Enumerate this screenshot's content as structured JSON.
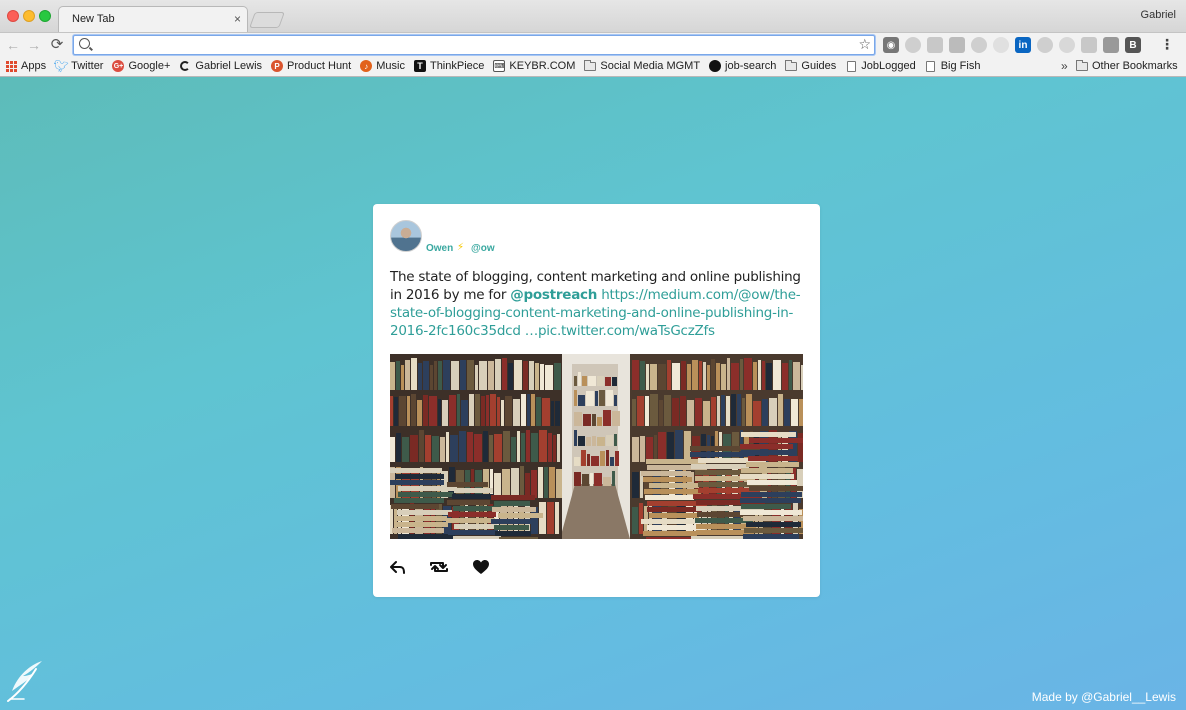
{
  "window": {
    "tab_title": "New Tab",
    "tab_close": "×",
    "profile_name": "Gabriel"
  },
  "toolbar": {
    "address_value": "",
    "address_placeholder": "",
    "extensions": [
      "ghostery-icon",
      "cloud-icon",
      "puzzle-icon",
      "cast-icon",
      "clock-icon",
      "extension-icon",
      "linkedin-icon",
      "settings-icon",
      "gem-icon",
      "window-icon",
      "grid-icon",
      "b-icon"
    ]
  },
  "bookmarks": {
    "items": [
      {
        "label": "Apps",
        "icon": "apps-grid-icon"
      },
      {
        "label": "Twitter",
        "icon": "twitter-icon"
      },
      {
        "label": "Google+",
        "icon": "google-plus-icon"
      },
      {
        "label": "Gabriel Lewis",
        "icon": "ring-icon"
      },
      {
        "label": "Product Hunt",
        "icon": "product-hunt-icon"
      },
      {
        "label": "Music",
        "icon": "music-icon"
      },
      {
        "label": "ThinkPiece",
        "icon": "thinkpiece-icon"
      },
      {
        "label": "KEYBR.COM",
        "icon": "keyboard-icon"
      },
      {
        "label": "Social Media MGMT",
        "icon": "folder-icon"
      },
      {
        "label": "job-search",
        "icon": "github-icon"
      },
      {
        "label": "Guides",
        "icon": "folder-icon"
      },
      {
        "label": "JobLogged",
        "icon": "page-icon"
      },
      {
        "label": "Big Fish",
        "icon": "page-icon"
      }
    ],
    "more": "»",
    "other": "Other Bookmarks"
  },
  "tweet": {
    "name": "Owen",
    "separator": "⚡",
    "handle": "@ow",
    "text_before": "The state of blogging, content marketing and online publishing in 2016 by me for ",
    "mention": "@postreach",
    "link": " https://medium.com/@ow/the-state-of-blogging-content-marketing-and-online-publishing-in-2016-2fc160c35dcd …pic.twitter.com/waTsGczZfs",
    "photo_subject": "bookstore aisle with stacked books",
    "actions": [
      "reply-icon",
      "retweet-icon",
      "like-heart-icon"
    ]
  },
  "footer": {
    "credit": "Made by @Gabriel__Lewis"
  },
  "colors": {
    "accent": "#2f9e98",
    "background_start": "#5dbcb9",
    "background_end": "#6ab4e6"
  }
}
